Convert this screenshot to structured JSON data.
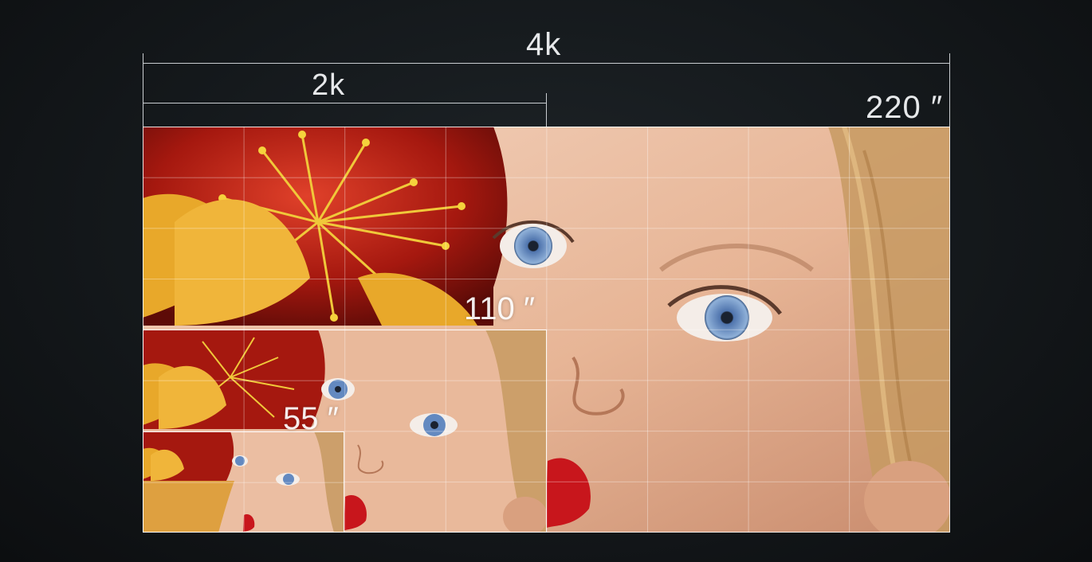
{
  "resolutions": {
    "large": "4k",
    "small": "2k"
  },
  "sizes": {
    "largest": "220 ″",
    "medium": "110 ″",
    "smallest": "55 ″"
  },
  "palette": {
    "background": "#14181b",
    "skin": "#e8b79a",
    "petal_yellow": "#e8a82a",
    "flower_red": "#c2281a",
    "eye_blue": "#5f86bd",
    "lip_red": "#c8161c",
    "line": "#c9cdd1"
  },
  "icons": {
    "portrait": "portrait-with-flowers-image"
  }
}
